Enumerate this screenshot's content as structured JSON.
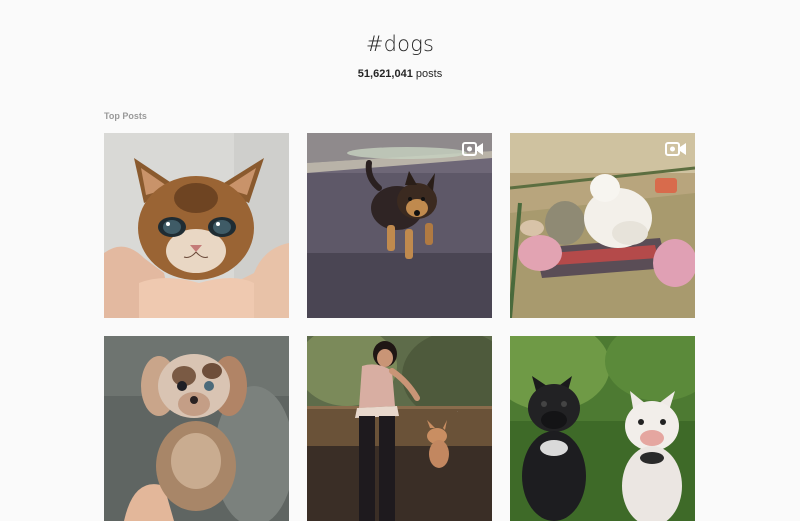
{
  "hashtag": {
    "title": "#dogs"
  },
  "stats": {
    "count": "51,621,041",
    "unit": "posts"
  },
  "top_posts": {
    "label": "Top Posts"
  },
  "posts": [
    {
      "subject": "kitten held in hands",
      "video": false
    },
    {
      "subject": "german shepherd puppy on road",
      "video": true
    },
    {
      "subject": "puppy sleeping on plush toys",
      "video": true
    },
    {
      "subject": "merle dachshund puppy",
      "video": false
    },
    {
      "subject": "woman playing with small dog",
      "video": false
    },
    {
      "subject": "black and white french bulldogs",
      "video": false
    }
  ],
  "icons": {
    "video": "video-camera-icon"
  },
  "colors": {
    "background": "#fafafa",
    "text": "#262626",
    "muted": "#999999"
  }
}
